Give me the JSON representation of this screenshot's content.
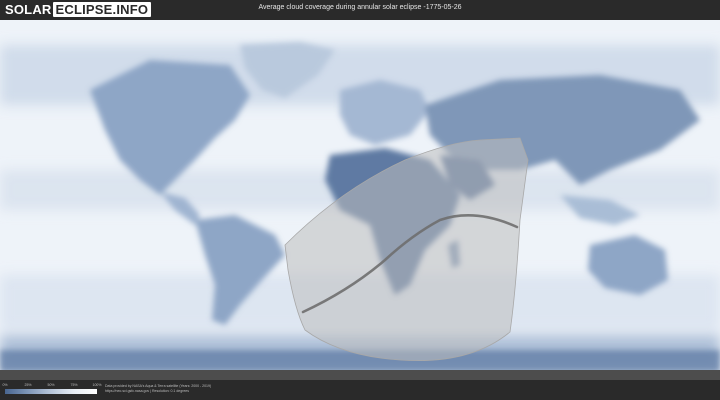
{
  "header": {
    "logo_part1": "SOLAR",
    "logo_part2": "ECLIPSE.INFO",
    "title": "Average cloud coverage during annular solar eclipse -1775-05-26"
  },
  "legend": {
    "ticks": [
      "0%",
      "25%",
      "50%",
      "75%",
      "100%"
    ],
    "colors": [
      "#496690",
      "#7f97b8",
      "#b7c6da",
      "#e8eef5",
      "#ffffff"
    ]
  },
  "credits": {
    "line1": "Data provided by NASA's Aqua & Terra satellite (Years: 2000 - 2019)",
    "line2": "https://neo.sci.gsfc.nasa.gov | Resolution: 0.1 degrees"
  },
  "map": {
    "ocean_color": "#eef3f9",
    "land_cloud_color": "#8ea6c6",
    "dense_cloud_color": "#5e7aa3",
    "shadow_color": "#bdbdbd",
    "path_color": "#6f6f6f"
  }
}
